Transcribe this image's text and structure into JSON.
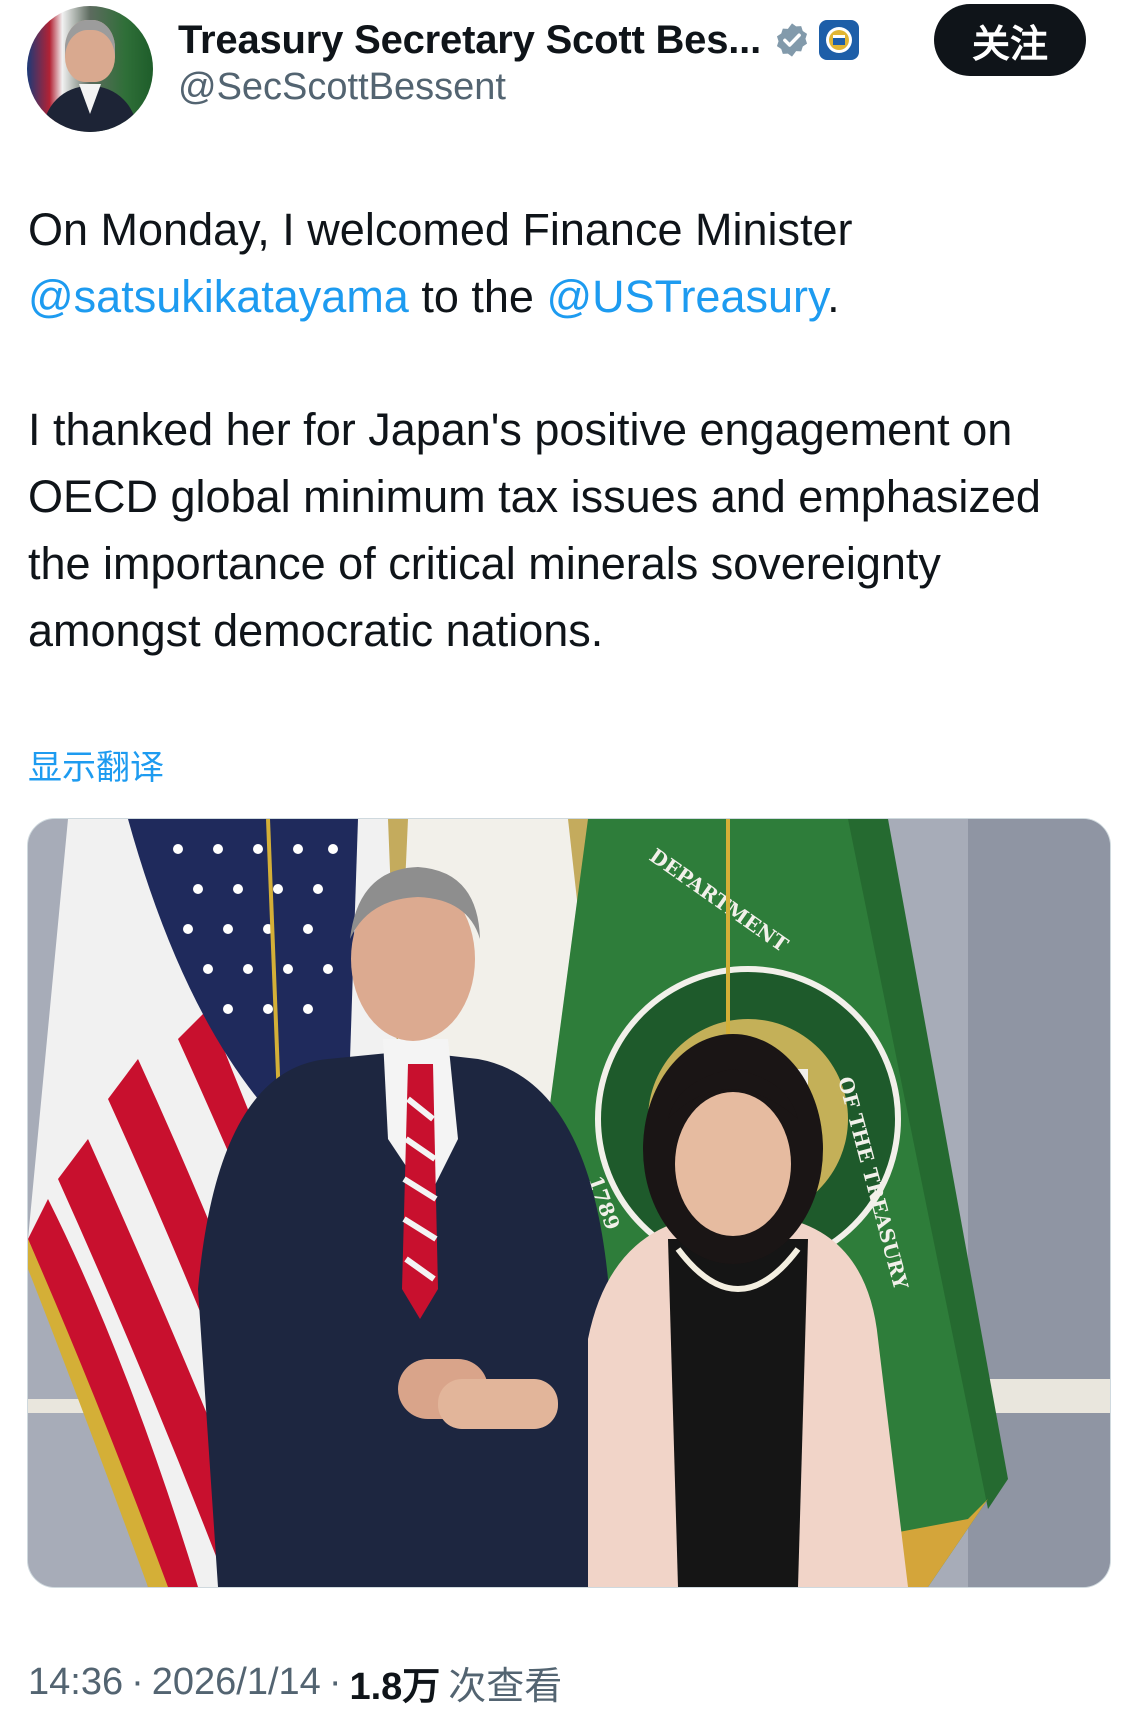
{
  "author": {
    "display_name": "Treasury Secretary Scott Bes...",
    "handle": "@SecScottBessent",
    "avatar_icon": "profile-photo",
    "verified_icon": "verified-badge-icon",
    "affiliation_icon": "treasury-seal-icon"
  },
  "follow_button": {
    "label": "关注"
  },
  "tweet": {
    "line1_text": "On Monday, I welcomed Finance Minister",
    "mention1": "@satsukikatayama",
    "mid_text": " to the ",
    "mention2": "@USTreasury",
    "end_text": ".",
    "paragraph2": "I thanked her for Japan's positive engagement on OECD global minimum tax issues and emphasized the importance of critical minerals sovereignty amongst democratic nations."
  },
  "show_translation": "显示翻译",
  "media": {
    "flag_text_top": "DEPARTMENT",
    "flag_text_side": "OF THE TREASURY",
    "flag_year": "1789"
  },
  "meta": {
    "time": "14:36",
    "date": "2026/1/14",
    "views": "1.8万",
    "views_label": "次查看",
    "separator": "·"
  },
  "colors": {
    "link": "#1d9bf0",
    "text": "#0f1419",
    "secondary": "#536471",
    "follow_bg": "#0f1419"
  }
}
